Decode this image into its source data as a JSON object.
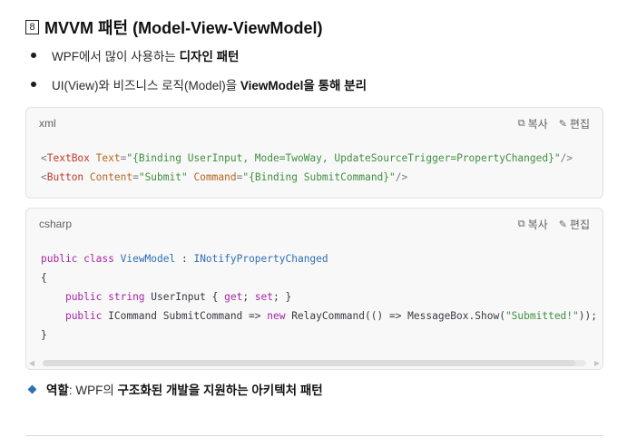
{
  "heading": {
    "badge": "8",
    "title": "MVVM 패턴 (Model-View-ViewModel)"
  },
  "bullets": [
    {
      "prefix": "WPF에서 많이 사용하는 ",
      "bold": "디자인 패턴",
      "suffix": ""
    },
    {
      "prefix": "UI(View)와 비즈니스 로직(Model)을 ",
      "bold": "ViewModel을 통해 분리",
      "suffix": ""
    }
  ],
  "code_blocks": [
    {
      "lang": "xml",
      "copy_label": "복사",
      "edit_label": "편집",
      "lines": [
        "<TextBox Text=\"{Binding UserInput, Mode=TwoWay, UpdateSourceTrigger=PropertyChanged}\"/>",
        "<Button Content=\"Submit\" Command=\"{Binding SubmitCommand}\"/>"
      ]
    },
    {
      "lang": "csharp",
      "copy_label": "복사",
      "edit_label": "편집",
      "lines": [
        "public class ViewModel : INotifyPropertyChanged",
        "{",
        "    public string UserInput { get; set; }",
        "    public ICommand SubmitCommand => new RelayCommand(() => MessageBox.Show(\"Submitted!\"));",
        "}"
      ]
    }
  ],
  "role": {
    "label": "역할",
    "text": ": WPF의 ",
    "bold": "구조화된 개발을 지원하는 아키텍처 패턴"
  },
  "colors": {
    "accent": "#2f6fb3",
    "code_bg": "#f8f8f8",
    "string": "#3f8f3f",
    "keyword": "#a626a4",
    "tag": "#c0392b"
  },
  "icons": {
    "copy": "copy-icon",
    "edit": "pencil-icon"
  }
}
